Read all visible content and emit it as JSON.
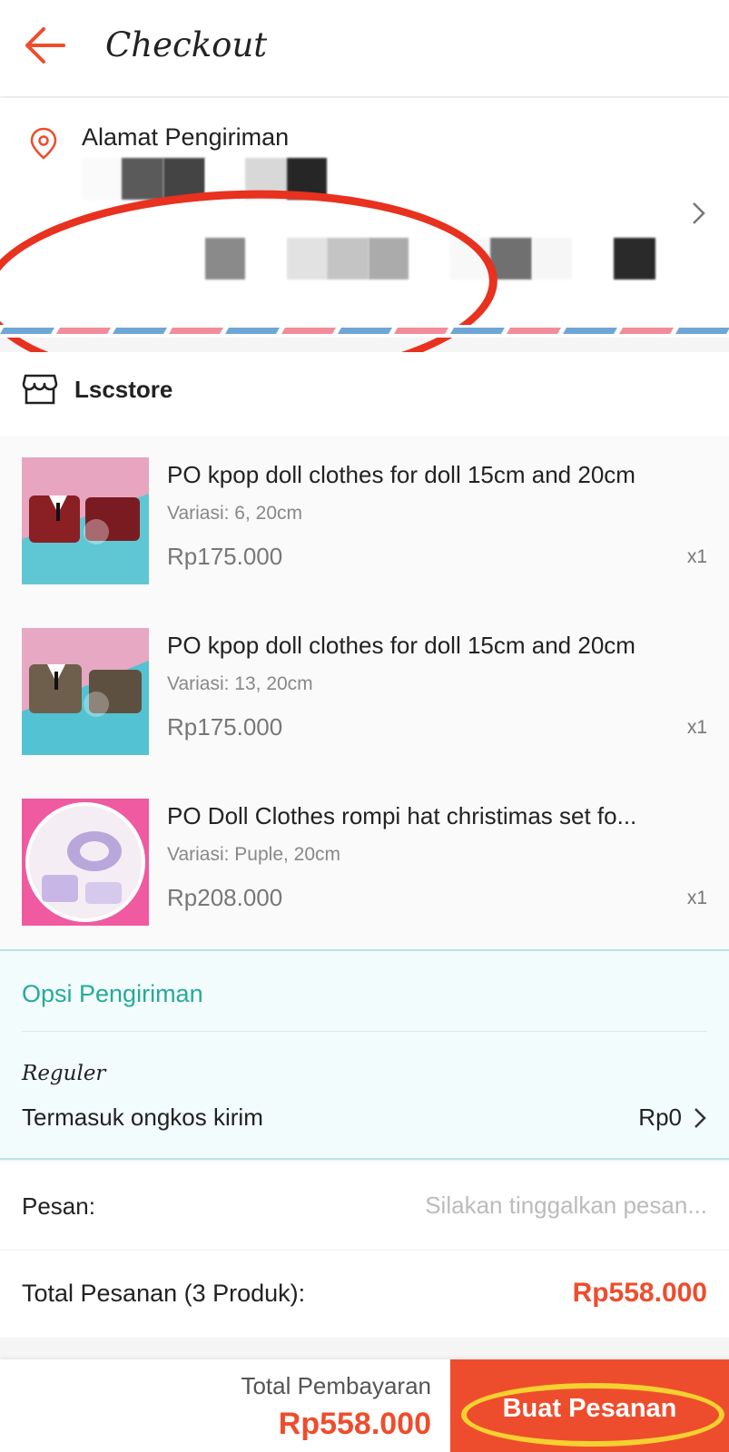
{
  "header": {
    "title": "Checkout"
  },
  "address": {
    "label": "Alamat Pengiriman"
  },
  "store": {
    "name": "Lscstore"
  },
  "products": [
    {
      "name": "PO kpop doll clothes for doll 15cm and 20cm",
      "variation": "Variasi: 6, 20cm",
      "price": "Rp175.000",
      "qty": "x1"
    },
    {
      "name": "PO kpop doll clothes for doll 15cm and 20cm",
      "variation": "Variasi: 13, 20cm",
      "price": "Rp175.000",
      "qty": "x1"
    },
    {
      "name": "PO Doll Clothes rompi hat christimas set fo...",
      "variation": "Variasi: Puple, 20cm",
      "price": "Rp208.000",
      "qty": "x1"
    }
  ],
  "shipping": {
    "title": "Opsi Pengiriman",
    "type": "Reguler",
    "description": "Termasuk ongkos kirim",
    "cost": "Rp0"
  },
  "message": {
    "label": "Pesan:",
    "placeholder": "Silakan tinggalkan pesan..."
  },
  "order_total": {
    "label": "Total Pesanan (3 Produk):",
    "value": "Rp558.000"
  },
  "footer": {
    "total_label": "Total Pembayaran",
    "total_value": "Rp558.000",
    "order_button": "Buat Pesanan"
  },
  "colors": {
    "accent": "#ee4d2d",
    "teal": "#26aa99",
    "annotation_red": "#e8311f",
    "annotation_yellow": "#f5d130"
  }
}
